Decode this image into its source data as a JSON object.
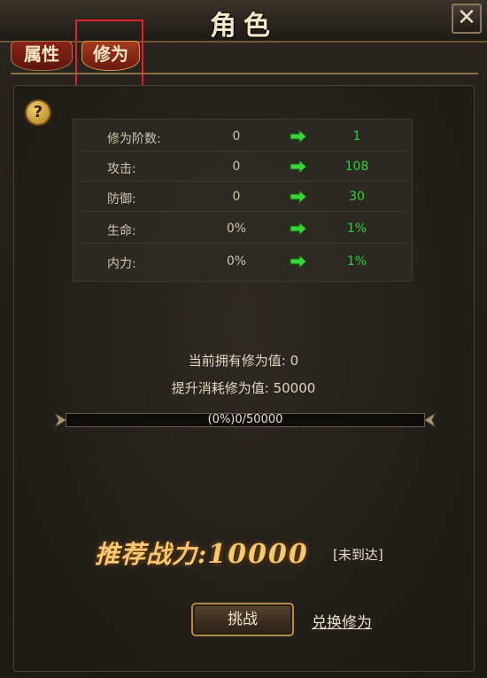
{
  "window": {
    "title": "角色",
    "close_label": "✕"
  },
  "tabs": [
    {
      "label": "属性",
      "active": false
    },
    {
      "label": "修为",
      "active": true
    }
  ],
  "help": {
    "label": "?"
  },
  "stats": {
    "rows": [
      {
        "label": "修为阶数:",
        "current": "0",
        "next": "1"
      },
      {
        "label": "攻击:",
        "current": "0",
        "next": "108"
      },
      {
        "label": "防御:",
        "current": "0",
        "next": "30"
      },
      {
        "label": "生命:",
        "current": "0%",
        "next": "1%"
      },
      {
        "label": "内力:",
        "current": "0%",
        "next": "1%"
      }
    ],
    "arrow_icon": "right-arrow-icon"
  },
  "cultivation": {
    "owned_label": "当前拥有修为值:",
    "owned_value": "0",
    "cost_label": "提升消耗修为值:",
    "cost_value": "50000"
  },
  "progress": {
    "text": "(0%)0/50000",
    "fraction": 0.0
  },
  "recommend": {
    "label": "推荐战力:",
    "value": "10000",
    "status": "[未到达]"
  },
  "buttons": {
    "challenge": "挑战",
    "exchange": "兑换修为"
  },
  "colors": {
    "next_value": "#2cd13a",
    "power": "#f7c874",
    "highlight_box": "#e0232a"
  }
}
